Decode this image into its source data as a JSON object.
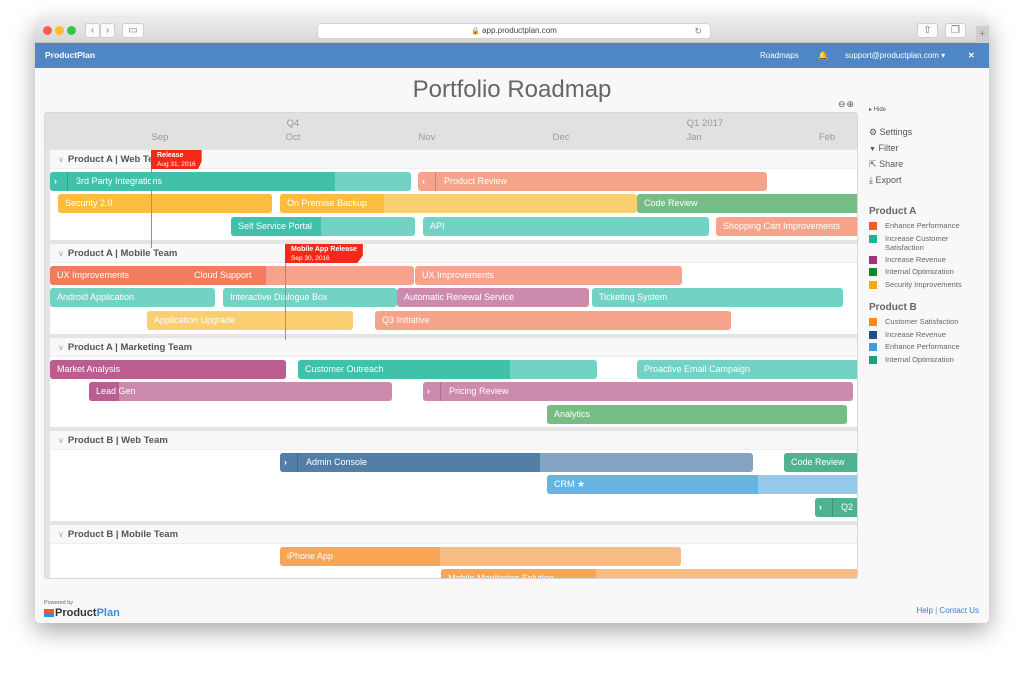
{
  "browser": {
    "url": "app.productplan.com",
    "back_icon": "‹",
    "forward_icon": "›",
    "reload_icon": "↻",
    "new_tab_icon": "+"
  },
  "navbar": {
    "brand": "ProductPlan",
    "roadmaps": "Roadmaps",
    "bell_icon": "🔔",
    "user": "support@productplan.com ▾",
    "expand_icon": "✕"
  },
  "page": {
    "title": "Portfolio Roadmap",
    "zoom_out_icon": "⊖",
    "zoom_in_icon": "⊕"
  },
  "timeline": {
    "quarters": [
      {
        "label": "Q4",
        "month_index": 1
      },
      {
        "label": "Q1 2017",
        "month_index": 4
      }
    ],
    "months": [
      "Sep",
      "Oct",
      "Nov",
      "Dec",
      "Jan",
      "Feb"
    ]
  },
  "milestones": [
    {
      "name": "Release",
      "date": "Aug 31, 2016",
      "color": "#f5291a"
    },
    {
      "name": "Mobile App Release",
      "date": "Sep 30, 2016",
      "color": "#f5291a"
    }
  ],
  "lanes": [
    {
      "title": "Product A | Web Team",
      "bars": [
        {
          "label": "3rd Party Integrations",
          "expand": true,
          "color": "#72d2c3",
          "progress_color": "#3fc1aa",
          "progress": 0.79
        },
        {
          "label": "Product Review",
          "expand": true,
          "color": "#f5a38a",
          "progress_color": "#f5a38a",
          "progress": 0
        },
        {
          "label": "Security 2.0",
          "color": "#fbbd40",
          "progress_color": "#fbbd40",
          "progress": 1
        },
        {
          "label": "On Premise Backup",
          "color": "#f9cf72",
          "progress_color": "#fbbd40",
          "progress": 0.29
        },
        {
          "label": "Code Review",
          "color": "#75bd84",
          "progress_color": "#75bd84",
          "progress": 1
        },
        {
          "label": "Self Service Portal",
          "color": "#72d2c3",
          "progress_color": "#3fc1aa",
          "progress": 0.49
        },
        {
          "label": "API",
          "color": "#72d2c3",
          "progress_color": "#72d2c3",
          "progress": 0
        },
        {
          "label": "Shopping Cart Improvements",
          "color": "#f5a38a",
          "progress_color": "#f5a38a",
          "progress": 0
        }
      ]
    },
    {
      "title": "Product A | Mobile Team",
      "bars": [
        {
          "label": "UX Improvements",
          "color": "#f27c5e",
          "progress_color": "#f27c5e",
          "progress": 1
        },
        {
          "label": "Cloud Support",
          "color": "#f5a38a",
          "progress_color": "#f27c5e",
          "progress": 0.35
        },
        {
          "label": "UX Improvements",
          "color": "#f5a38a",
          "progress_color": "#f5a38a",
          "progress": 0
        },
        {
          "label": "Android Application",
          "color": "#72d2c3",
          "progress_color": "#72d2c3",
          "progress": 0
        },
        {
          "label": "Interactive Dialogue Box",
          "color": "#72d2c3",
          "progress_color": "#72d2c3",
          "progress": 0
        },
        {
          "label": "Automatic Renewal Service",
          "color": "#cc8aad",
          "progress_color": "#cc8aad",
          "progress": 0
        },
        {
          "label": "Ticketing System",
          "color": "#72d2c3",
          "progress_color": "#72d2c3",
          "progress": 0
        },
        {
          "label": "Application Upgrade",
          "color": "#f9cf72",
          "progress_color": "#f9cf72",
          "progress": 0
        },
        {
          "label": "Q3 Initiative",
          "color": "#f5a38a",
          "progress_color": "#f5a38a",
          "progress": 0
        }
      ]
    },
    {
      "title": "Product A | Marketing Team",
      "bars": [
        {
          "label": "Market Analysis",
          "color": "#b95e8f",
          "progress_color": "#b95e8f",
          "progress": 1
        },
        {
          "label": "Customer Outreach",
          "color": "#72d2c3",
          "progress_color": "#3fc1aa",
          "progress": 0.71
        },
        {
          "label": "Proactive Email Campaign",
          "color": "#72d2c3",
          "progress_color": "#72d2c3",
          "progress": 0
        },
        {
          "label": "Lead Gen",
          "color": "#cc8aad",
          "progress_color": "#b95e8f",
          "progress": 0.1
        },
        {
          "label": "Pricing Review",
          "expand": true,
          "color": "#cc8aad",
          "progress_color": "#cc8aad",
          "progress": 0
        },
        {
          "label": "Analytics",
          "color": "#75bd84",
          "progress_color": "#75bd84",
          "progress": 1
        }
      ]
    },
    {
      "title": "Product B | Web Team",
      "bars": [
        {
          "label": "Admin Console",
          "expand": true,
          "color": "#84a4c2",
          "progress_color": "#537fa6",
          "progress": 0.55
        },
        {
          "label": "Code Review",
          "color": "#4fb391",
          "progress_color": "#4fb391",
          "progress": 1
        },
        {
          "label": "CRM ★",
          "color": "#96c9ea",
          "progress_color": "#66b4e0",
          "progress": 0.66
        },
        {
          "label": "Q2",
          "expand": true,
          "color": "#4fb391",
          "progress_color": "#4fb391",
          "progress": 1
        }
      ]
    },
    {
      "title": "Product B | Mobile Team",
      "bars": [
        {
          "label": "iPhone App",
          "color": "#f8bc84",
          "progress_color": "#f8a653",
          "progress": 0.4
        },
        {
          "label": "Mobile Monitoring Solution",
          "color": "#f8bc84",
          "progress_color": "#f8a653",
          "progress": 0.37
        }
      ]
    }
  ],
  "sidebar": {
    "hide": "▸ Hide",
    "actions": [
      {
        "icon": "⚙",
        "label": "Settings"
      },
      {
        "icon": "▼",
        "label": "Filter"
      },
      {
        "icon": "⇱",
        "label": "Share"
      },
      {
        "icon": "⤓",
        "label": "Export"
      }
    ],
    "legends": [
      {
        "title": "Product A",
        "items": [
          {
            "label": "Enhance Performance",
            "color": "#f15a2b"
          },
          {
            "label": "Increase Customer Satisfaction",
            "color": "#1ab394"
          },
          {
            "label": "Increase Revenue",
            "color": "#a3317c"
          },
          {
            "label": "Internal Optimization",
            "color": "#108a28"
          },
          {
            "label": "Security Improvements",
            "color": "#f9a80f"
          }
        ]
      },
      {
        "title": "Product B",
        "items": [
          {
            "label": "Customer Satisfaction",
            "color": "#f98a1f"
          },
          {
            "label": "Increase Revenue",
            "color": "#1f4f86"
          },
          {
            "label": "Enhance Performance",
            "color": "#3e9ddc"
          },
          {
            "label": "Internal Optimization",
            "color": "#1f9e7a"
          }
        ]
      }
    ]
  },
  "footer": {
    "powered_by": "Powered by",
    "logo_product": "Product",
    "logo_plan": "Plan",
    "help": "Help",
    "separator": " | ",
    "contact": "Contact Us"
  }
}
